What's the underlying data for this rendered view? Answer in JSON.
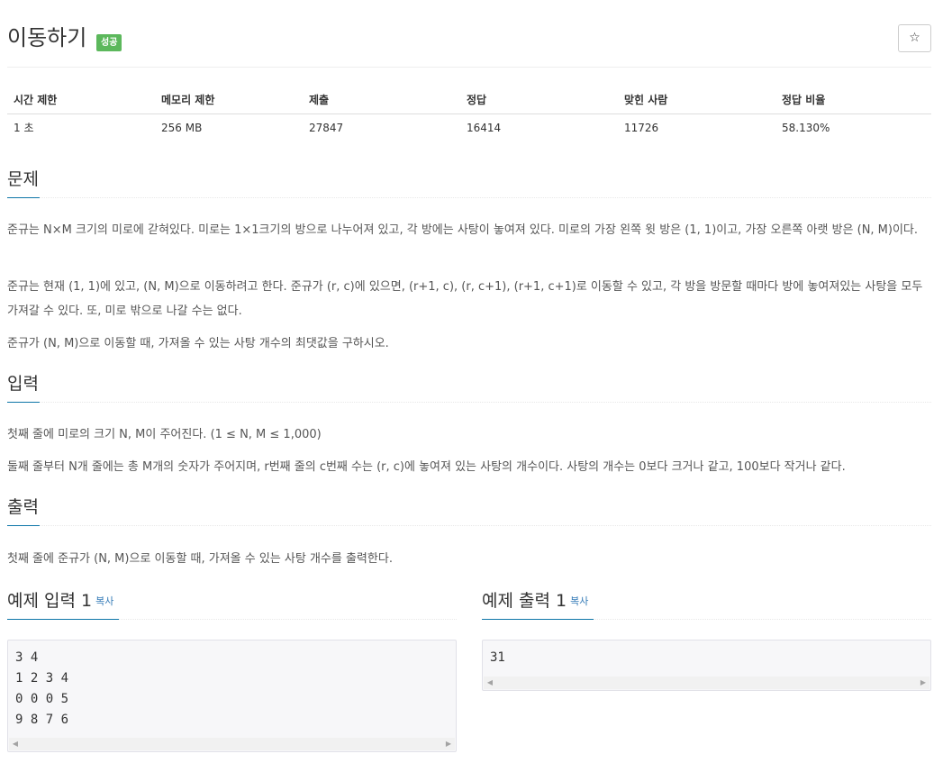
{
  "problem": {
    "title": "이동하기",
    "badge": "성공"
  },
  "icons": {
    "star": "☆",
    "scroll_left": "◀",
    "scroll_right": "▶"
  },
  "stats": {
    "headers": [
      "시간 제한",
      "메모리 제한",
      "제출",
      "정답",
      "맞힌 사람",
      "정답 비율"
    ],
    "values": [
      "1 초",
      "256 MB",
      "27847",
      "16414",
      "11726",
      "58.130%"
    ]
  },
  "sections": {
    "problem": {
      "heading": "문제",
      "paragraphs": [
        "준규는 N×M 크기의 미로에 갇혀있다. 미로는 1×1크기의 방으로 나누어져 있고, 각 방에는 사탕이 놓여져 있다. 미로의 가장 왼쪽 윗 방은 (1, 1)이고, 가장 오른쪽 아랫 방은 (N, M)이다.",
        "준규는 현재 (1, 1)에 있고, (N, M)으로 이동하려고 한다. 준규가 (r, c)에 있으면, (r+1, c), (r, c+1), (r+1, c+1)로 이동할 수 있고, 각 방을 방문할 때마다 방에 놓여져있는 사탕을 모두 가져갈 수 있다. 또, 미로 밖으로 나갈 수는 없다.",
        "준규가 (N, M)으로 이동할 때, 가져올 수 있는 사탕 개수의 최댓값을 구하시오."
      ]
    },
    "input": {
      "heading": "입력",
      "paragraphs": [
        "첫째 줄에 미로의 크기 N, M이 주어진다. (1 ≤ N, M ≤ 1,000)",
        "둘째 줄부터 N개 줄에는 총 M개의 숫자가 주어지며, r번째 줄의 c번째 수는 (r, c)에 놓여져 있는 사탕의 개수이다. 사탕의 개수는 0보다 크거나 같고, 100보다 작거나 같다."
      ]
    },
    "output": {
      "heading": "출력",
      "paragraphs": [
        "첫째 줄에 준규가 (N, M)으로 이동할 때, 가져올 수 있는 사탕 개수를 출력한다."
      ]
    }
  },
  "samples": {
    "input": {
      "heading": "예제 입력 1",
      "copy_label": "복사",
      "content": "3 4\n1 2 3 4\n0 0 0 5\n9 8 7 6"
    },
    "output": {
      "heading": "예제 출력 1",
      "copy_label": "복사",
      "content": "31"
    }
  }
}
